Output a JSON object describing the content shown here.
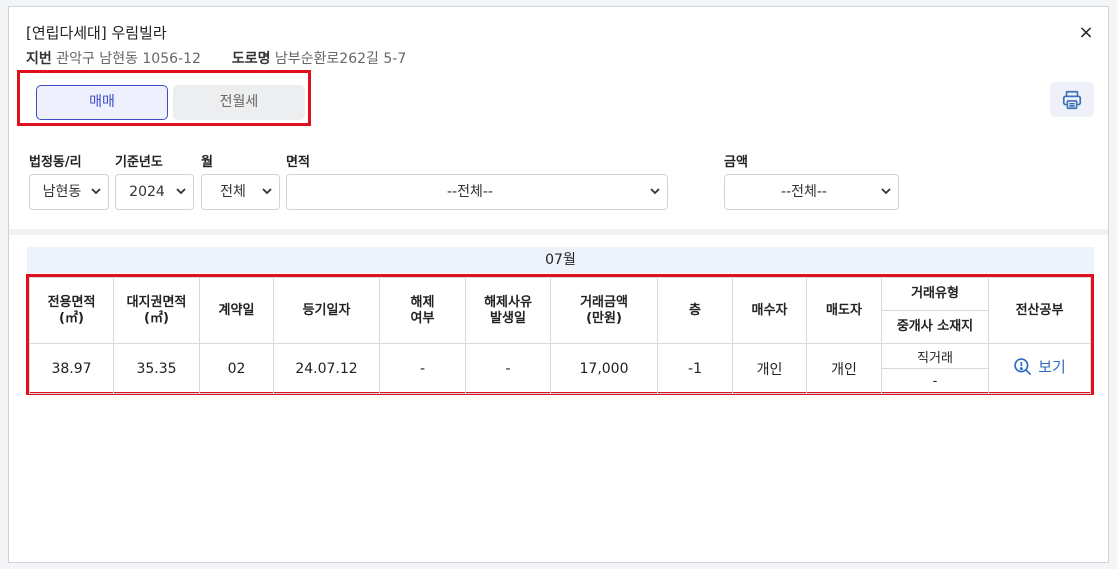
{
  "modal": {
    "title": "[연립다세대] 우림빌라",
    "jibun_label": "지번",
    "jibun_value": "관악구 남현동 1056-12",
    "road_label": "도로명",
    "road_value": "남부순환로262길 5-7",
    "close_icon": "×"
  },
  "tabs": {
    "sale": "매매",
    "rent": "전월세"
  },
  "filters": {
    "dong": {
      "label": "법정동/리",
      "value": "남현동"
    },
    "year": {
      "label": "기준년도",
      "value": "2024"
    },
    "month": {
      "label": "월",
      "value": "전체"
    },
    "area": {
      "label": "면적",
      "value": "--전체--"
    },
    "amount": {
      "label": "금액",
      "value": "--전체--"
    }
  },
  "table": {
    "month_title": "07월",
    "headers": {
      "excl_area": "전용면적\n(㎡)",
      "land_area": "대지권면적\n(㎡)",
      "contract_day": "계약일",
      "reg_date": "등기일자",
      "cancel": "해제\n여부",
      "cancel_date": "해제사유\n발생일",
      "price": "거래금액\n(만원)",
      "floor": "층",
      "buyer": "매수자",
      "seller": "매도자",
      "deal_type": "거래유형",
      "broker_loc": "중개사 소재지",
      "registry": "전산공부"
    },
    "row": {
      "excl_area": "38.97",
      "land_area": "35.35",
      "contract_day": "02",
      "reg_date": "24.07.12",
      "cancel": "-",
      "cancel_date": "-",
      "price": "17,000",
      "floor": "-1",
      "buyer": "개인",
      "seller": "개인",
      "deal_type": "직거래",
      "broker_loc": "-",
      "registry_link": "보기"
    }
  },
  "colors": {
    "accent": "#3b4ec7",
    "highlight_border": "#e0101c",
    "link": "#2c6cc4"
  }
}
